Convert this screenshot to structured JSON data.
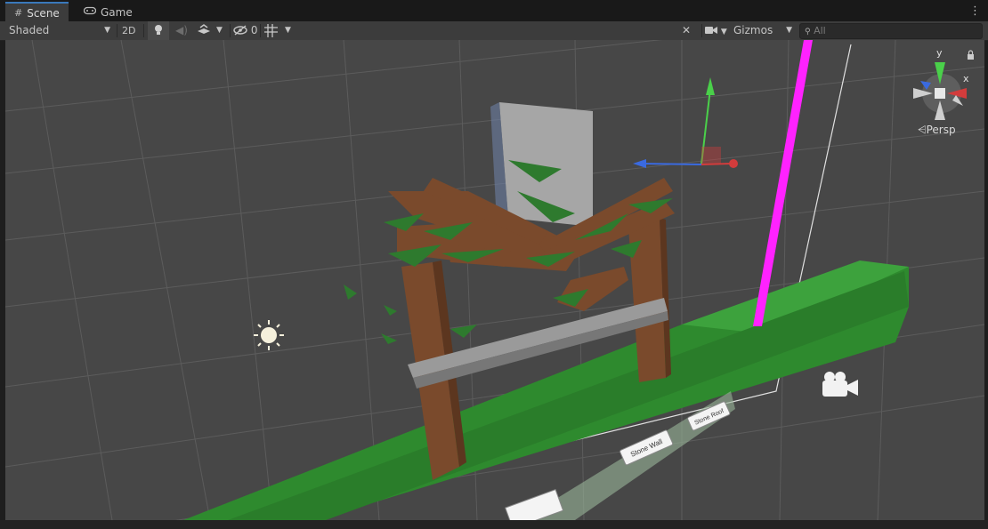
{
  "tabs": [
    {
      "label": "Scene",
      "icon": "grid-icon"
    },
    {
      "label": "Game",
      "icon": "gamepad-icon"
    }
  ],
  "toolbar": {
    "shading_mode": "Shaded",
    "mode_2d": "2D",
    "hidden_count": "0",
    "gizmos": "Gizmos",
    "search_placeholder": "All"
  },
  "orientation_gizmo": {
    "axis_y": "y",
    "axis_x": "x",
    "projection": "Persp"
  },
  "scene_labels": {
    "stone_wall": "Stone Wall",
    "stone_roof": "Stone Roof"
  },
  "colors": {
    "grass": "#2f8a2f",
    "wood": "#7a4a2c",
    "leaf": "#2e7a2e",
    "boundary": "#ff22ff",
    "axis_y": "#4ad04a",
    "axis_x": "#d23c3c",
    "axis_z": "#3a6ae0"
  }
}
